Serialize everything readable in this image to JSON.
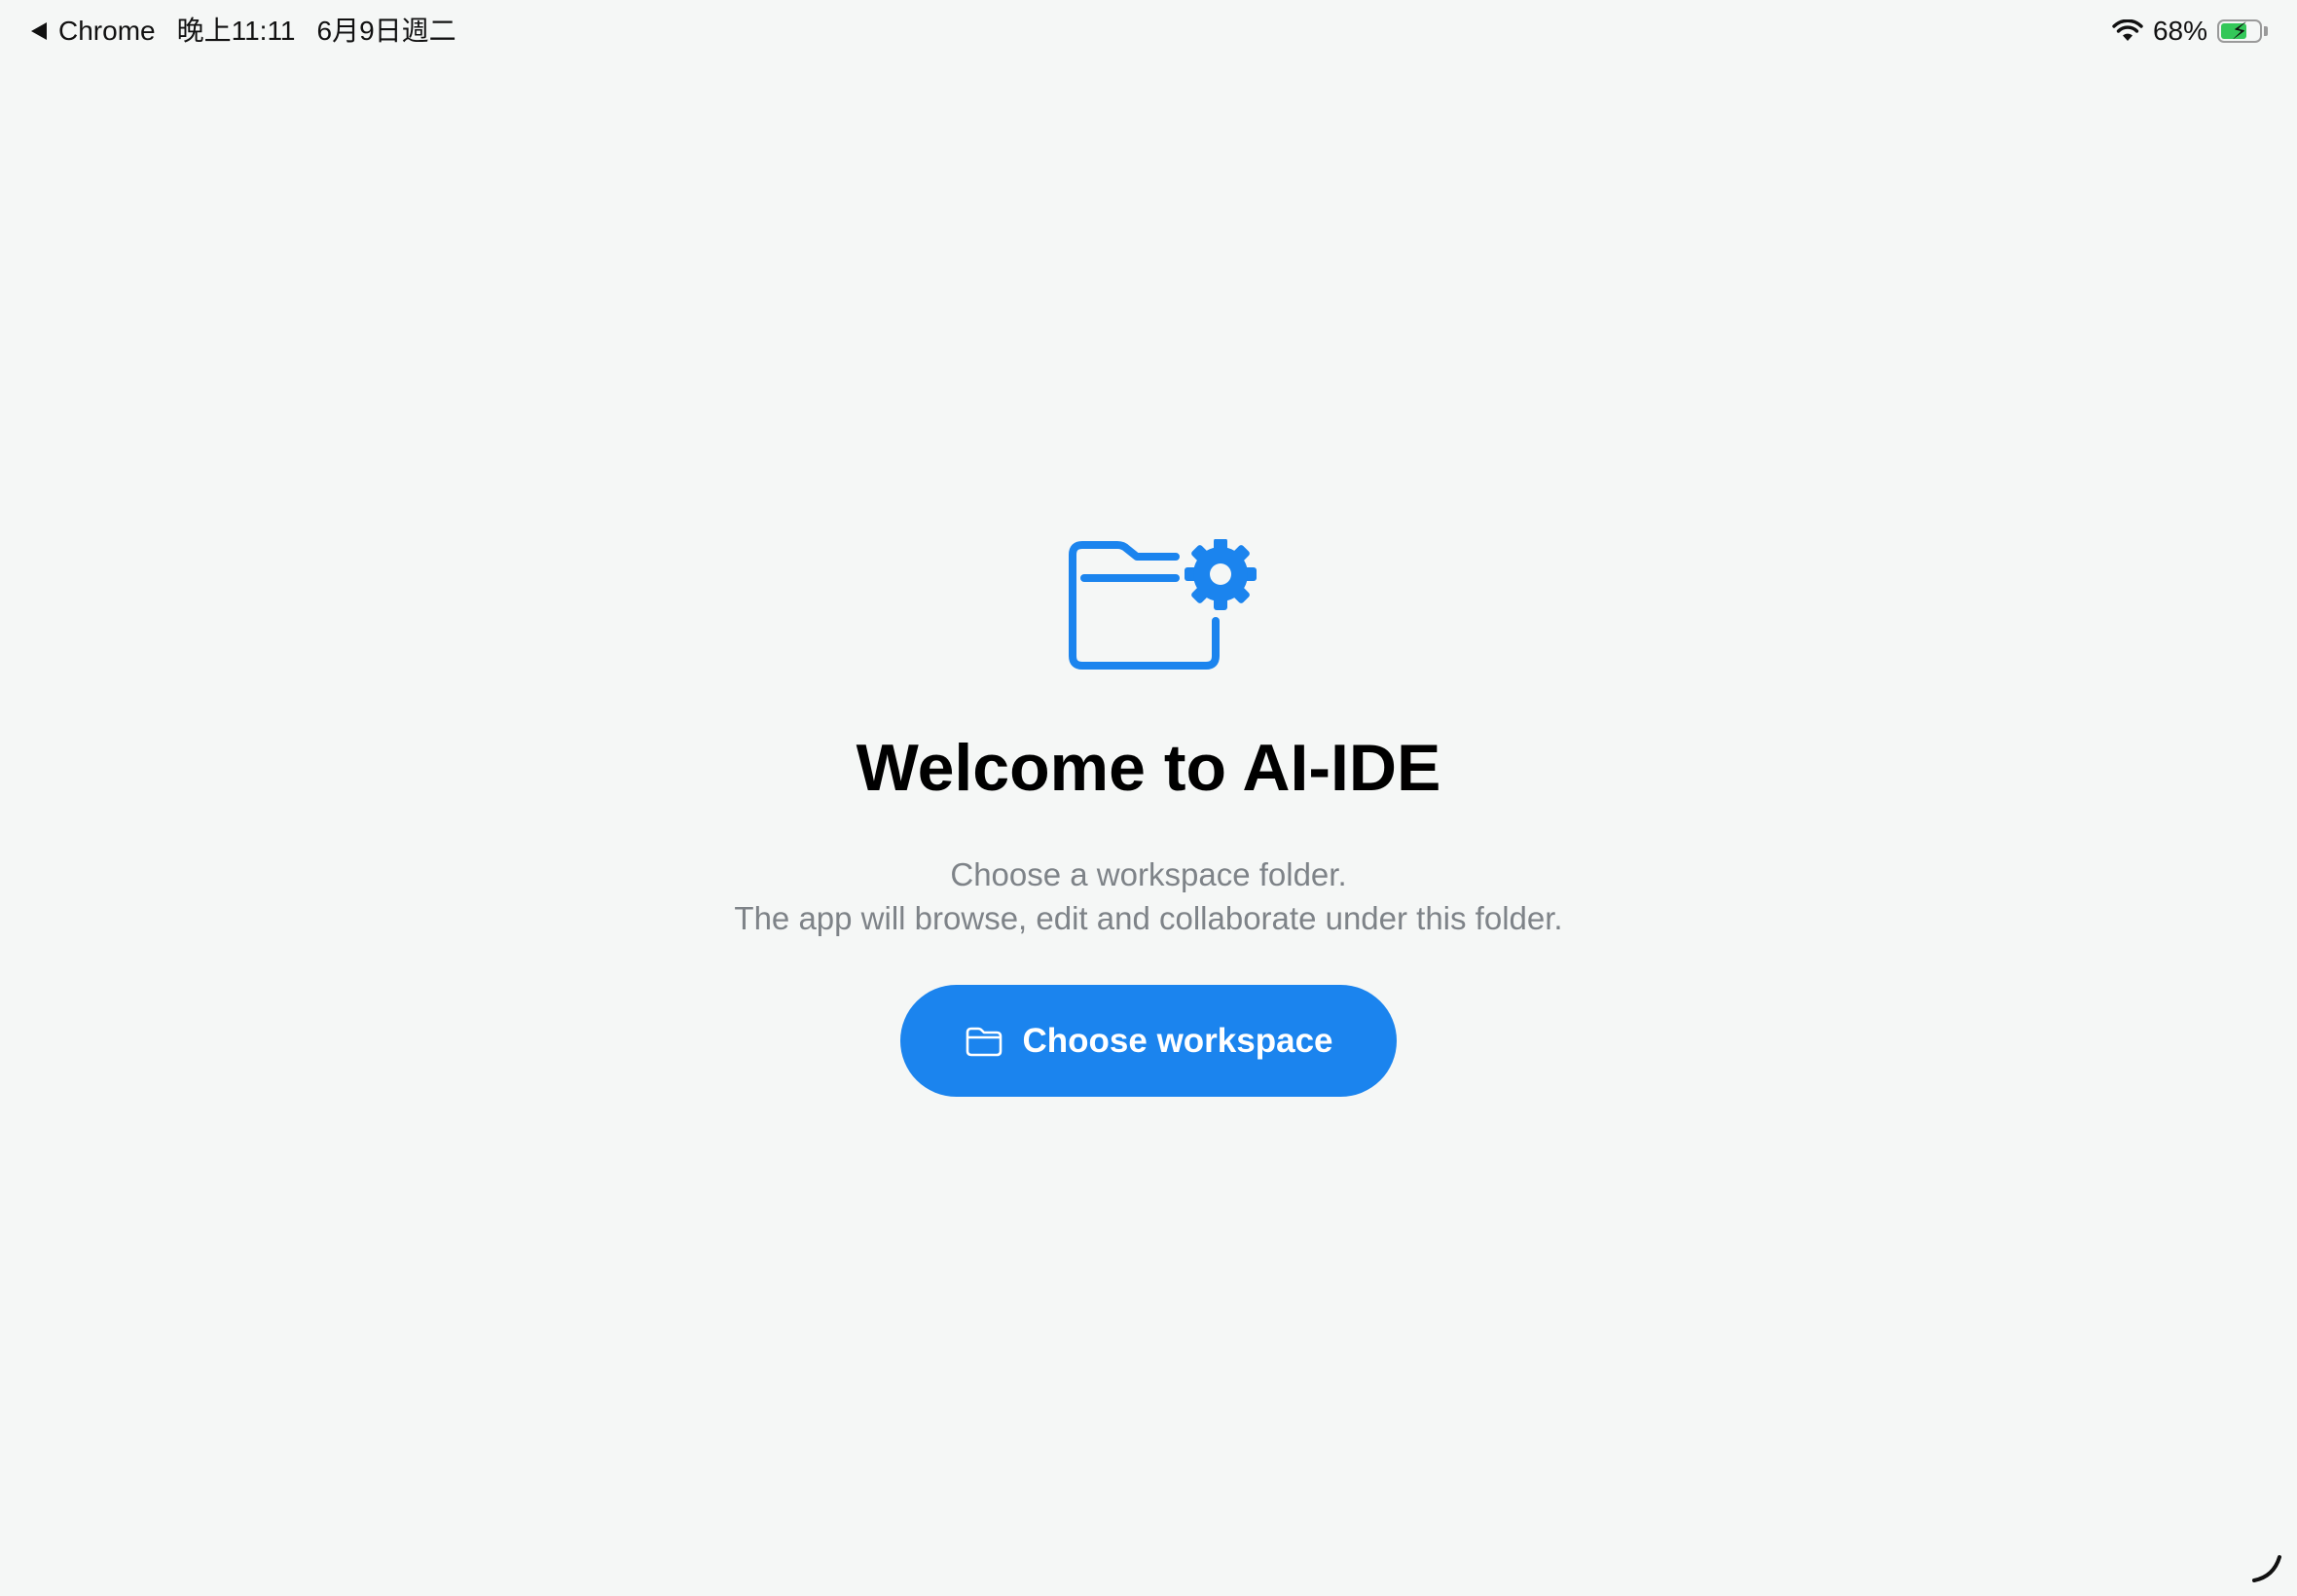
{
  "status_bar": {
    "back_app": "Chrome",
    "time": "晚上11:11",
    "date": "6月9日週二",
    "battery_percent": "68%",
    "battery_level": 0.68,
    "charging": true,
    "wifi_icon": "wifi-icon"
  },
  "welcome": {
    "icon": "folder-gear-icon",
    "title": "Welcome to AI-IDE",
    "subtitle_line1": "Choose a workspace folder.",
    "subtitle_line2": "The app will browse, edit and collaborate under this folder."
  },
  "choose_button": {
    "label": "Choose workspace",
    "icon": "folder-icon",
    "color": "#1b84ee"
  },
  "colors": {
    "background": "#f5f7f6",
    "accent": "#1b84ee",
    "subtitle": "#7e8388"
  }
}
